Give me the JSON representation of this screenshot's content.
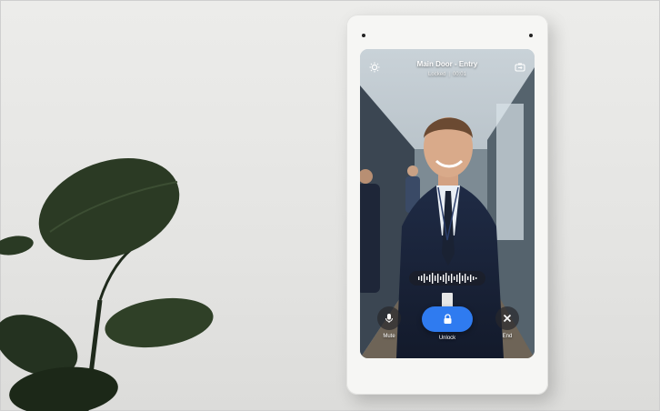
{
  "call": {
    "title": "Main Door - Entry",
    "state": "Locked",
    "separator": "|",
    "timer": "00:01"
  },
  "controls": {
    "mute_label": "Mute",
    "unlock_label": "Unlock",
    "end_label": "End"
  },
  "icons": {
    "top_left": "light-icon",
    "top_right": "camera-switch-icon",
    "mute": "microphone-icon",
    "unlock": "lock-icon",
    "end": "close-icon"
  },
  "colors": {
    "unlock_accent": "#2f7bf0",
    "device_body": "#f6f6f4",
    "wall": "#e8e8e6"
  }
}
